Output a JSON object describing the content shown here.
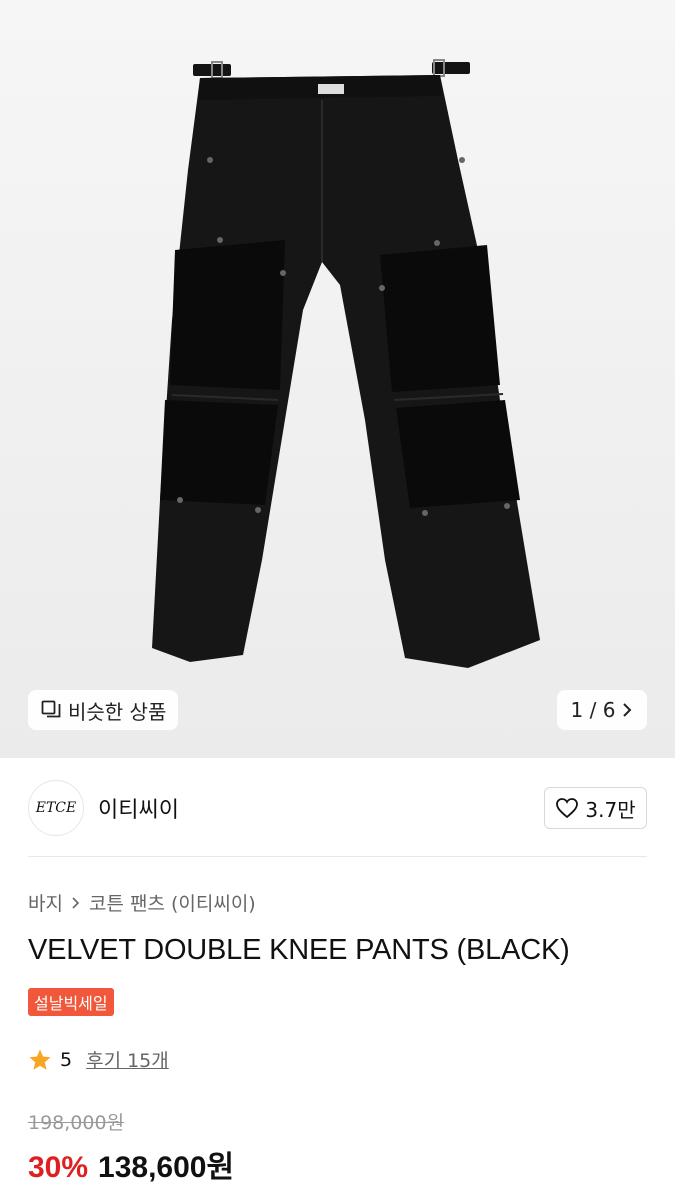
{
  "gallery": {
    "similar_label": "비슷한 상품",
    "pager": "1 / 6",
    "image_subject": "black double knee pants"
  },
  "brand": {
    "logo_text": "ETCE",
    "name": "이티씨이",
    "likes": "3.7만"
  },
  "breadcrumb": {
    "category": "바지",
    "subcategory": "코튼 팬츠 (이티씨이)"
  },
  "product": {
    "title": "VELVET DOUBLE KNEE PANTS (BLACK)",
    "badge": "설날빅세일",
    "rating": "5",
    "reviews": "후기 15개",
    "original_price": "198,000원",
    "discount": "30%",
    "price": "138,600원"
  },
  "colors": {
    "accent_red": "#e02020",
    "badge_orange": "#f0573b",
    "star": "#f5a623"
  }
}
